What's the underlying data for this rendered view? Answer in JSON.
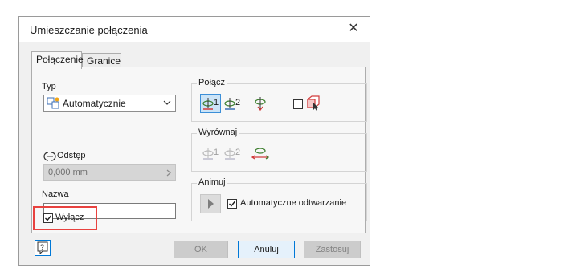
{
  "dialog": {
    "title": "Umieszczanie połączenia",
    "close_glyph": "✕"
  },
  "tabs": [
    {
      "label": "Połączenie",
      "active": true
    },
    {
      "label": "Granice",
      "active": false
    }
  ],
  "left": {
    "type_label": "Typ",
    "type_value": "Automatycznie",
    "type_icon": "automatic-joint-icon",
    "offset_label": "Odstęp",
    "offset_value": "0,000 mm",
    "name_label": "Nazwa",
    "name_value": "",
    "disable_label": "Wyłącz",
    "disable_checked": true
  },
  "connect": {
    "label": "Połącz",
    "origin1_label": "1",
    "origin2_label": "2",
    "flip_icon": "flip-component-icon",
    "grounded_icon": "red-cube-cursor-icon"
  },
  "align": {
    "label": "Wyrównaj",
    "align1_label": "1",
    "align2_label": "2",
    "invert_icon": "invert-alignment-icon"
  },
  "animate": {
    "label": "Animuj",
    "play_icon": "play-icon",
    "autoplay_label": "Automatyczne odtwarzanie",
    "autoplay_checked": true
  },
  "footer": {
    "help_icon": "help-icon",
    "ok_label": "OK",
    "cancel_label": "Anuluj",
    "apply_label": "Zastosuj"
  },
  "colors": {
    "highlight": "#e8423f",
    "selected_button": "#cce4f7",
    "accent": "#0078d7"
  }
}
